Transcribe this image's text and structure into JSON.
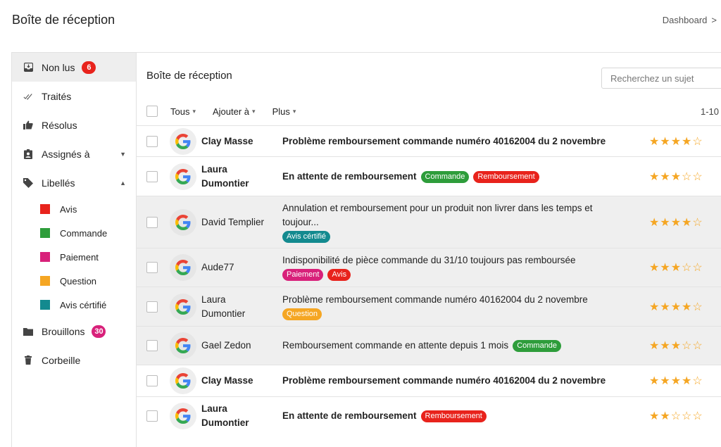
{
  "header": {
    "title": "Boîte de réception",
    "breadcrumb": [
      "Dashboard",
      ">"
    ]
  },
  "colors": {
    "red": "#e8231c",
    "green": "#2e9d3b",
    "pink": "#d8217a",
    "orange": "#f5a623",
    "teal": "#138a8f",
    "star": "#f5a623"
  },
  "sidebar": {
    "items": [
      {
        "label": "Non lus",
        "icon": "inbox-icon",
        "badge": "6",
        "badge_color": "#e8231c",
        "active": true
      },
      {
        "label": "Traités",
        "icon": "double-check-icon"
      },
      {
        "label": "Résolus",
        "icon": "thumbs-up-icon"
      },
      {
        "label": "Assignés à",
        "icon": "assigned-badge-icon",
        "caret": "▼"
      },
      {
        "label": "Libellés",
        "icon": "tag-icon",
        "caret": "▲"
      },
      {
        "label": "Brouillons",
        "icon": "folder-icon",
        "badge": "30",
        "badge_color": "#d8217a"
      },
      {
        "label": "Corbeille",
        "icon": "trash-icon"
      }
    ],
    "labels": [
      {
        "label": "Avis",
        "color": "#e8231c"
      },
      {
        "label": "Commande",
        "color": "#2e9d3b"
      },
      {
        "label": "Paiement",
        "color": "#d8217a"
      },
      {
        "label": "Question",
        "color": "#f5a623"
      },
      {
        "label": "Avis cértifié",
        "color": "#138a8f"
      }
    ]
  },
  "main": {
    "title": "Boîte de réception",
    "search_placeholder": "Recherchez un sujet",
    "toolbar": {
      "all": "Tous",
      "add_to": "Ajouter à",
      "more": "Plus",
      "pager": "1-10"
    },
    "rows": [
      {
        "sender": "Clay Masse",
        "subject": "Problème remboursement commande numéro 40162004 du 2 novembre",
        "tags": [],
        "stars": 4,
        "unread": true
      },
      {
        "sender": "Laura Dumontier",
        "subject": "En attente de remboursement",
        "tags": [
          {
            "label": "Commande",
            "color": "#2e9d3b"
          },
          {
            "label": "Remboursement",
            "color": "#e8231c"
          }
        ],
        "stars": 3,
        "unread": true
      },
      {
        "sender": "David Templier",
        "subject": "Annulation et remboursement pour un produit non livrer dans les temps et toujour...",
        "tags": [
          {
            "label": "Avis cértifié",
            "color": "#138a8f"
          }
        ],
        "stars": 4,
        "unread": false
      },
      {
        "sender": "Aude77",
        "subject": "Indisponibilité de pièce commande du 31/10 toujours pas remboursée",
        "tags": [
          {
            "label": "Paiement",
            "color": "#d8217a"
          },
          {
            "label": "Avis",
            "color": "#e8231c"
          }
        ],
        "stars": 3,
        "unread": false
      },
      {
        "sender": "Laura Dumontier",
        "subject": "Problème remboursement commande numéro 40162004 du 2 novembre",
        "tags": [
          {
            "label": "Question",
            "color": "#f5a623"
          }
        ],
        "stars": 4,
        "unread": false
      },
      {
        "sender": "Gael Zedon",
        "subject": "Remboursement commande en attente depuis 1 mois",
        "tags": [
          {
            "label": "Commande",
            "color": "#2e9d3b"
          }
        ],
        "stars": 3,
        "unread": false
      },
      {
        "sender": "Clay Masse",
        "subject": "Problème remboursement commande numéro 40162004 du 2 novembre",
        "tags": [],
        "stars": 4,
        "unread": true
      },
      {
        "sender": "Laura Dumontier",
        "subject": "En attente de remboursement",
        "tags": [
          {
            "label": "Remboursement",
            "color": "#e8231c"
          }
        ],
        "stars": 2,
        "unread": true
      }
    ]
  }
}
